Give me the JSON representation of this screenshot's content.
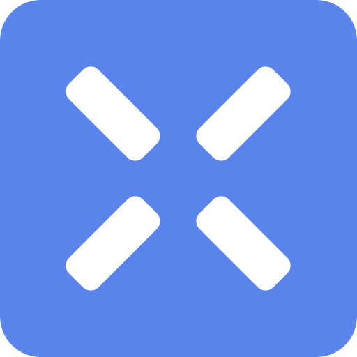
{
  "icon": {
    "name": "x-close-icon",
    "background_color": "#5A84EA",
    "glyph_color": "#FFFFFF"
  }
}
